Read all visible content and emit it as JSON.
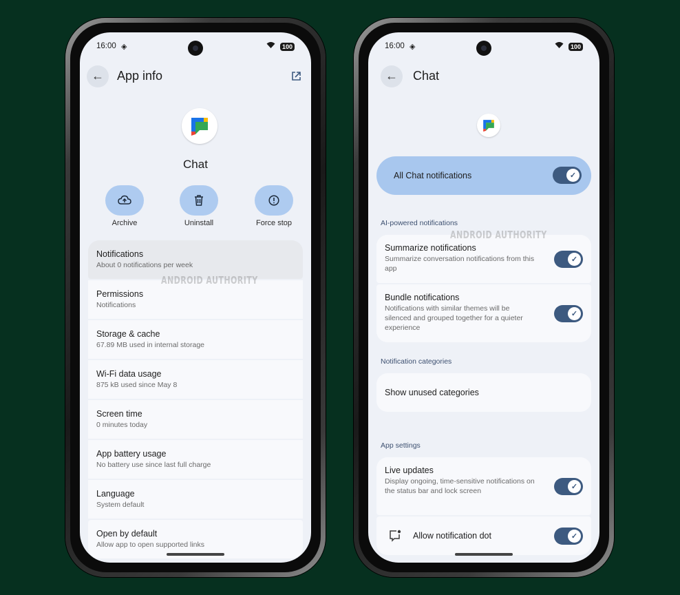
{
  "status_bar": {
    "time": "16:00",
    "battery": "100"
  },
  "left_phone": {
    "title": "App info",
    "app_name": "Chat",
    "actions": [
      {
        "label": "Archive",
        "icon": "cloud-upload-icon"
      },
      {
        "label": "Uninstall",
        "icon": "trash-icon"
      },
      {
        "label": "Force stop",
        "icon": "alert-circle-icon"
      }
    ],
    "items": [
      {
        "title": "Notifications",
        "subtitle": "About 0 notifications per week"
      },
      {
        "title": "Permissions",
        "subtitle": "Notifications"
      },
      {
        "title": "Storage & cache",
        "subtitle": "67.89 MB used in internal storage"
      },
      {
        "title": "Wi-Fi data usage",
        "subtitle": "875 kB used since May 8"
      },
      {
        "title": "Screen time",
        "subtitle": "0 minutes today"
      },
      {
        "title": "App battery usage",
        "subtitle": "No battery use since last full charge"
      },
      {
        "title": "Language",
        "subtitle": "System default"
      },
      {
        "title": "Open by default",
        "subtitle": "Allow app to open supported links"
      }
    ],
    "watermark": "ANDROID AUTHORITY"
  },
  "right_phone": {
    "title": "Chat",
    "master_toggle": {
      "label": "All Chat notifications",
      "on": true
    },
    "ai_section": "AI-powered notifications",
    "summarize": {
      "title": "Summarize notifications",
      "subtitle": "Summarize conversation notifications from this app",
      "on": true
    },
    "bundle": {
      "title": "Bundle notifications",
      "subtitle": "Notifications with similar themes will be silenced and grouped together for a quieter experience",
      "on": true
    },
    "categories_section": "Notification categories",
    "show_unused": "Show unused categories",
    "app_settings_section": "App settings",
    "live_updates": {
      "title": "Live updates",
      "subtitle": "Display ongoing, time-sensitive notifications on the status bar and lock screen",
      "on": true
    },
    "notification_dot": {
      "title": "Allow notification dot",
      "on": true
    },
    "watermark": "ANDROID AUTHORITY"
  },
  "colors": {
    "background": "#06301f",
    "accent": "#a8c7ee",
    "toggle_on": "#3d5a80"
  }
}
